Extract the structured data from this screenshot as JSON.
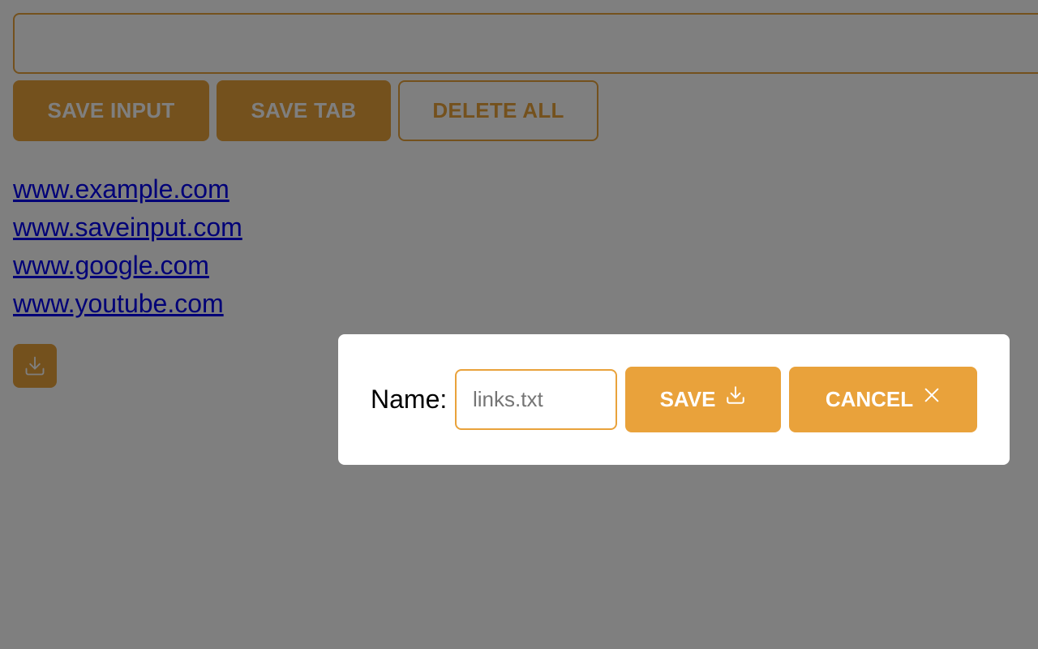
{
  "colors": {
    "accent": "#E9A23B",
    "link": "#0000EE",
    "overlay": "rgba(0,0,0,0.5)"
  },
  "main": {
    "url_input_value": "",
    "buttons": {
      "save_input": "SAVE INPUT",
      "save_tab": "SAVE TAB",
      "delete_all": "DELETE ALL"
    },
    "links": [
      "www.example.com",
      "www.saveinput.com",
      "www.google.com",
      "www.youtube.com"
    ],
    "download_icon": "download-icon"
  },
  "modal": {
    "label": "Name:",
    "filename_placeholder": "links.txt",
    "save_label": "SAVE",
    "save_icon": "download-icon",
    "cancel_label": "CANCEL",
    "cancel_icon": "close-icon"
  }
}
